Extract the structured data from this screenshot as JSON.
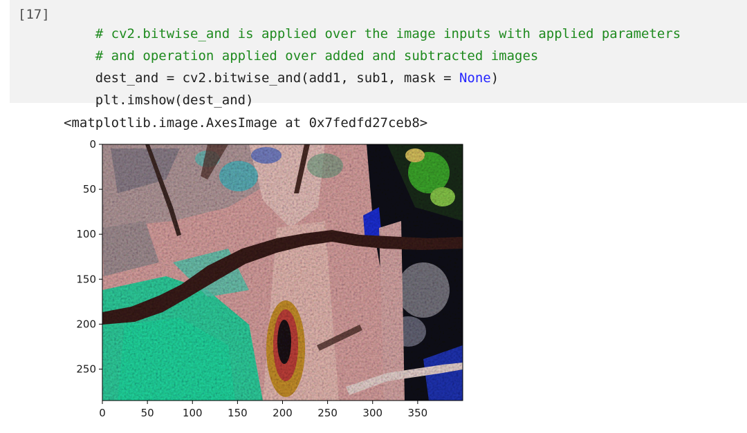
{
  "cell": {
    "execution_count": "[17]",
    "code_lines": [
      {
        "segments": [
          {
            "t": "# cv2.bitwise_and is applied over the image inputs with applied parameters",
            "c": "comment"
          }
        ]
      },
      {
        "segments": [
          {
            "t": "# and operation applied over added and subtracted images",
            "c": "comment"
          }
        ]
      },
      {
        "segments": [
          {
            "t": "dest_and = cv2.bitwise_and(add1, sub1, mask = ",
            "c": "plain"
          },
          {
            "t": "None",
            "c": "kw"
          },
          {
            "t": ")",
            "c": "plain"
          }
        ]
      },
      {
        "segments": [
          {
            "t": "plt.imshow(dest_and)",
            "c": "plain"
          }
        ]
      }
    ],
    "output_text": "<matplotlib.image.AxesImage at 0x7fedfd27ceb8>"
  },
  "chart_data": {
    "type": "image",
    "image_width": 400,
    "image_height": 285,
    "xlim": [
      0,
      400
    ],
    "ylim": [
      285,
      0
    ],
    "x_ticks": [
      0,
      50,
      100,
      150,
      200,
      250,
      300,
      350
    ],
    "y_ticks": [
      0,
      50,
      100,
      150,
      200,
      250
    ],
    "x_tick_labels": [
      "0",
      "50",
      "100",
      "150",
      "200",
      "250",
      "300",
      "350"
    ],
    "y_tick_labels": [
      "0",
      "50",
      "100",
      "150",
      "200",
      "250"
    ],
    "colors": {
      "pink": "#d9a1a0",
      "mauve": "#b49a9c",
      "teal": "#2fcf9e",
      "dark_branch": "#3a1d18",
      "black": "#0c0c10",
      "blue": "#1d2fd6",
      "green": "#3da82c",
      "orange": "#c8902a"
    }
  }
}
